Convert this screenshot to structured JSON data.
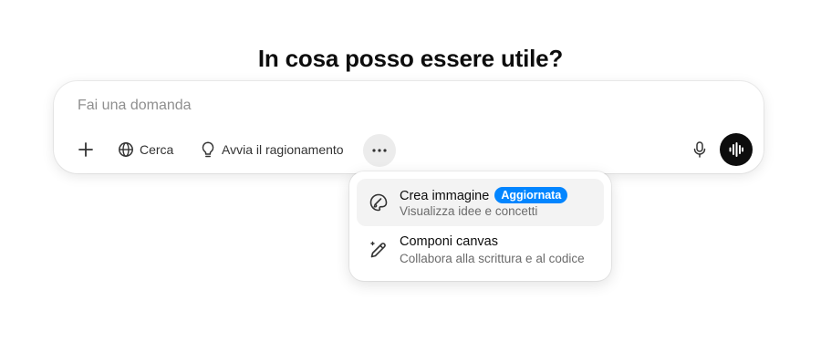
{
  "heading": "In cosa posso essere utile?",
  "composer": {
    "placeholder": "Fai una domanda",
    "tools": {
      "add_icon": "plus-icon",
      "search_label": "Cerca",
      "search_icon": "globe-icon",
      "reason_label": "Avvia il ragionamento",
      "reason_icon": "lightbulb-icon",
      "more_icon": "ellipsis-icon",
      "mic_icon": "microphone-icon",
      "voice_icon": "voice-waveform-icon"
    }
  },
  "tools_menu": {
    "items": [
      {
        "title": "Crea immagine",
        "badge": "Aggiornata",
        "subtitle": "Visualizza idee e concetti",
        "icon": "palette-brush-icon",
        "highlighted": true
      },
      {
        "title": "Componi canvas",
        "subtitle": "Collabora alla scrittura e al codice",
        "icon": "pencil-sparkle-icon",
        "highlighted": false
      }
    ]
  },
  "colors": {
    "badge": "#0285ff",
    "voice_button": "#0d0d0d",
    "more_button_bg": "#ececec",
    "menu_item_hover": "#f3f3f3"
  }
}
